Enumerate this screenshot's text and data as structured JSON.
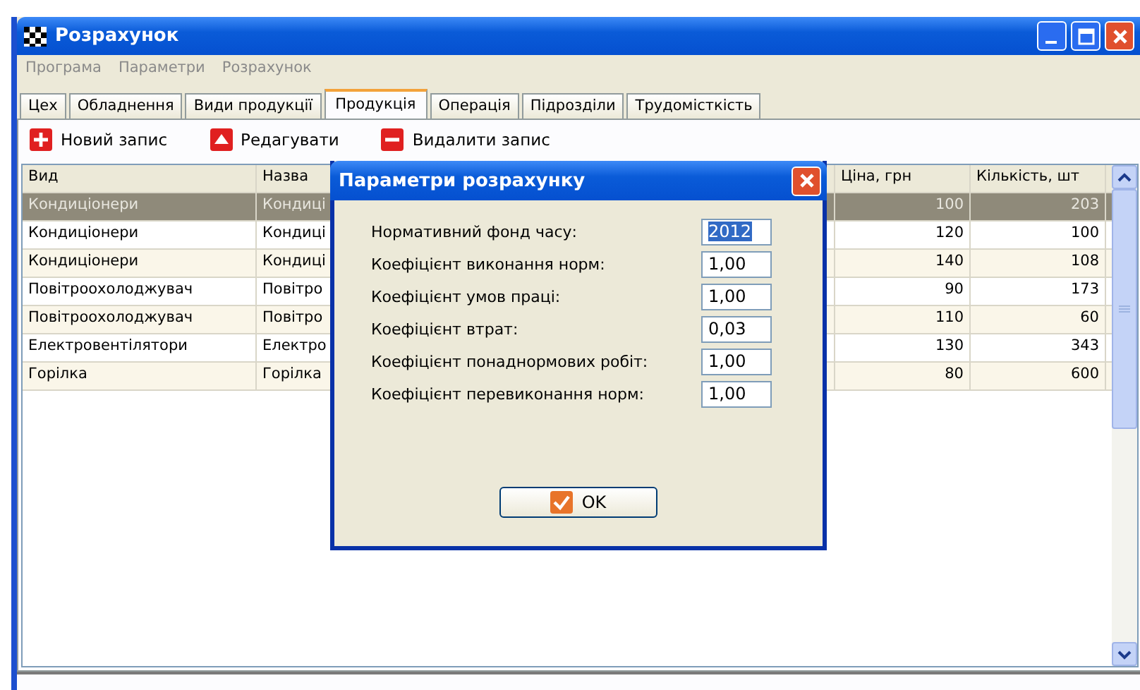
{
  "window": {
    "title": "Розрахунок"
  },
  "menu": [
    "Програма",
    "Параметри",
    "Розрахунок"
  ],
  "tabs": [
    {
      "label": "Цех",
      "selected": false
    },
    {
      "label": "Обладнення",
      "selected": false
    },
    {
      "label": "Види продукції",
      "selected": false
    },
    {
      "label": "Продукція",
      "selected": true
    },
    {
      "label": "Операція",
      "selected": false
    },
    {
      "label": "Підрозділи",
      "selected": false
    },
    {
      "label": "Трудомісткість",
      "selected": false
    }
  ],
  "toolbar": [
    {
      "kind": "add",
      "label": "Новий запис"
    },
    {
      "kind": "edit",
      "label": "Редагувати"
    },
    {
      "kind": "delete",
      "label": "Видалити запис"
    }
  ],
  "table": {
    "columns": [
      "Вид",
      "Назва",
      "Ціна, грн",
      "Кількість, шт"
    ],
    "rows": [
      {
        "cells": [
          "Кондиціонери",
          "Кондиці",
          "100",
          "203"
        ],
        "selected": true
      },
      {
        "cells": [
          "Кондиціонери",
          "Кондиці",
          "120",
          "100"
        ],
        "selected": false
      },
      {
        "cells": [
          "Кондиціонери",
          "Кондиці",
          "140",
          "108"
        ],
        "selected": false
      },
      {
        "cells": [
          "Повітроохолоджувач",
          "Повітро",
          "90",
          "173"
        ],
        "selected": false
      },
      {
        "cells": [
          "Повітроохолоджувач",
          "Повітро",
          "110",
          "60"
        ],
        "selected": false
      },
      {
        "cells": [
          "Електровентілятори",
          "Електро",
          "130",
          "343"
        ],
        "selected": false
      },
      {
        "cells": [
          "Горілка",
          "Горілка",
          "80",
          "600"
        ],
        "selected": false
      }
    ]
  },
  "dialog": {
    "title": "Параметри розрахунку",
    "fields": [
      {
        "label": "Нормативний фонд часу:",
        "value": "2012",
        "selected": true
      },
      {
        "label": "Коефіцієнт виконання норм:",
        "value": "1,00",
        "selected": false
      },
      {
        "label": "Коефіцієнт умов праці:",
        "value": "1,00",
        "selected": false
      },
      {
        "label": "Коефіцієнт втрат:",
        "value": "0,03",
        "selected": false
      },
      {
        "label": "Коефіцієнт понаднормових робіт:",
        "value": "1,00",
        "selected": false
      },
      {
        "label": "Коефіцієнт перевиконання норм:",
        "value": "1,00",
        "selected": false
      }
    ],
    "button": "OK"
  }
}
